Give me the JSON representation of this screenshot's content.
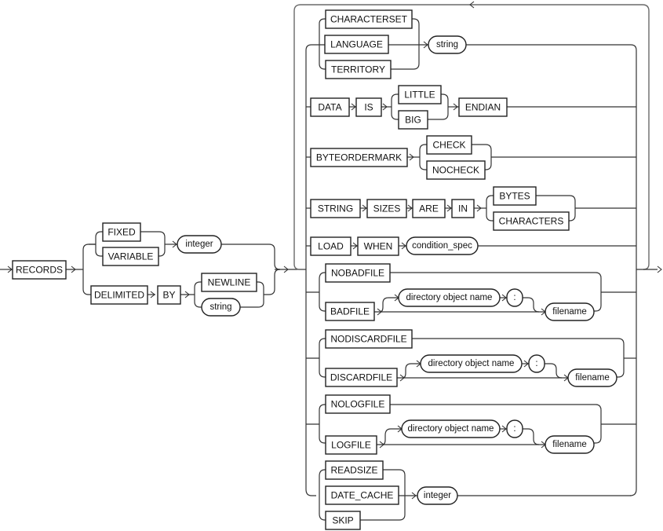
{
  "diagram": {
    "type": "syntax-railroad",
    "title": "",
    "keywords": {
      "records": "RECORDS",
      "fixed": "FIXED",
      "variable": "VARIABLE",
      "delimited": "DELIMITED",
      "by": "BY",
      "newline": "NEWLINE",
      "characterset": "CHARACTERSET",
      "language": "LANGUAGE",
      "territory": "TERRITORY",
      "data": "DATA",
      "is": "IS",
      "little": "LITTLE",
      "big": "BIG",
      "endian": "ENDIAN",
      "byteordermark": "BYTEORDERMARK",
      "check": "CHECK",
      "nocheck": "NOCHECK",
      "string_kw": "STRING",
      "sizes": "SIZES",
      "are": "ARE",
      "in": "IN",
      "bytes": "BYTES",
      "characters": "CHARACTERS",
      "load": "LOAD",
      "when": "WHEN",
      "nobadfile": "NOBADFILE",
      "badfile": "BADFILE",
      "nodiscardfile": "NODISCARDFILE",
      "discardfile": "DISCARDFILE",
      "nologfile": "NOLOGFILE",
      "logfile": "LOGFILE",
      "readsize": "READSIZE",
      "date_cache": "DATE_CACHE",
      "skip": "SKIP"
    },
    "nonterminals": {
      "integer": "integer",
      "string": "string",
      "condition_spec": "condition_spec",
      "directory_object_name": "directory object name",
      "colon": ":",
      "filename": "filename"
    }
  }
}
